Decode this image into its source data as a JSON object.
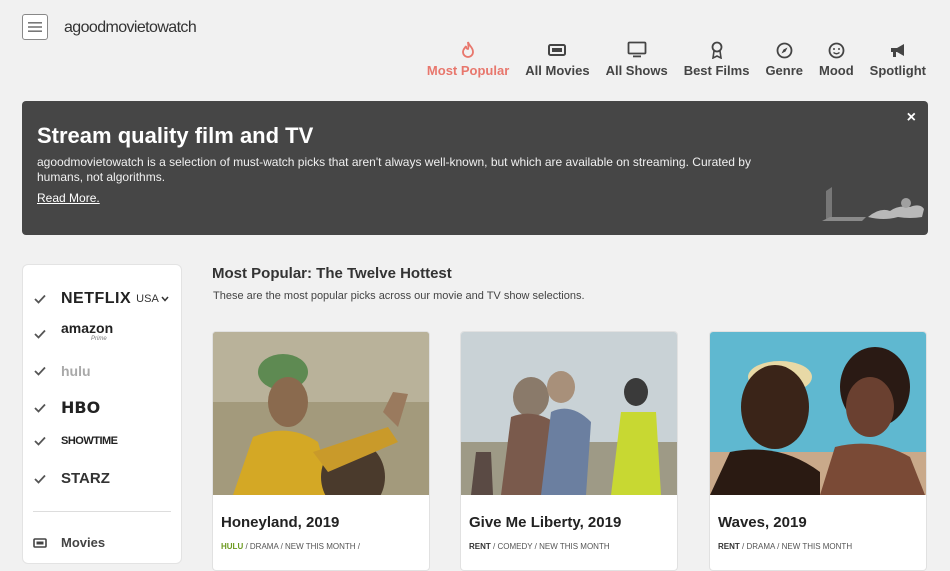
{
  "header": {
    "logo": "agoodmovietowatch",
    "nav": [
      {
        "label": "Most Popular",
        "icon": "flame-icon",
        "active": true
      },
      {
        "label": "All Movies",
        "icon": "film-icon"
      },
      {
        "label": "All Shows",
        "icon": "tv-icon"
      },
      {
        "label": "Best Films",
        "icon": "award-icon"
      },
      {
        "label": "Genre",
        "icon": "compass-icon"
      },
      {
        "label": "Mood",
        "icon": "smile-icon"
      },
      {
        "label": "Spotlight",
        "icon": "megaphone-icon"
      }
    ]
  },
  "banner": {
    "title": "Stream quality film and TV",
    "text": "agoodmovietowatch is a selection of must-watch picks that aren't always well-known, but which are available on streaming. Curated by humans, not algorithms.",
    "link": "Read More.",
    "close": "×"
  },
  "sidebar": {
    "services": [
      {
        "name": "NETFLIX",
        "checked": true,
        "region": "USA"
      },
      {
        "name": "amazon",
        "sub": "Prime",
        "checked": true
      },
      {
        "name": "hulu",
        "checked": true
      },
      {
        "name": "HBO",
        "checked": true
      },
      {
        "name": "SHOWTIME",
        "checked": true
      },
      {
        "name": "STARZ",
        "checked": true
      }
    ],
    "links": [
      {
        "label": "Movies",
        "icon": "film-icon"
      }
    ]
  },
  "main": {
    "title": "Most Popular: The Twelve Hottest",
    "subtitle": "These are the most popular picks across our movie and TV show selections.",
    "cards": [
      {
        "title": "Honeyland, 2019",
        "provider": "HULU",
        "tags": "/ DRAMA / NEW THIS MONTH /"
      },
      {
        "title": "Give Me Liberty, 2019",
        "provider": "RENT",
        "tags": "/ COMEDY / NEW THIS MONTH"
      },
      {
        "title": "Waves, 2019",
        "provider": "RENT",
        "tags": "/ DRAMA / NEW THIS MONTH"
      }
    ]
  },
  "colors": {
    "accent": "#e8776d",
    "banner_bg": "#464646",
    "hulu": "#6c9a1f"
  }
}
